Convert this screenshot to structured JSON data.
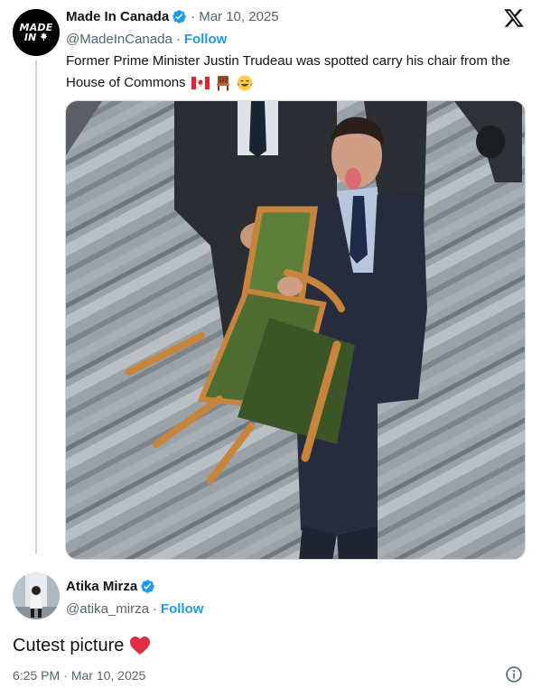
{
  "quoted": {
    "avatar_text": [
      "MADE",
      "IN"
    ],
    "name": "Made In Canada",
    "date": "Mar 10, 2025",
    "handle": "@MadeInCanada",
    "follow_label": "Follow",
    "text": "Former Prime Minister Justin Trudeau was spotted carry his chair from the House of Commons",
    "emojis": [
      "canada-flag-emoji",
      "chair-emoji",
      "joy-emoji"
    ],
    "date_separator": "·"
  },
  "reply": {
    "name": "Atika Mirza",
    "handle": "@atika_mirza",
    "follow_label": "Follow",
    "text": "Cutest picture",
    "time": "6:25 PM",
    "date": "Mar 10, 2025",
    "separator": "·"
  },
  "colors": {
    "accent": "#1d9bf0",
    "secondary_text": "#536471",
    "primary_text": "#0f1419",
    "divider": "#cfd9de",
    "heart": "#f91880"
  },
  "icons": {
    "platform": "x-logo-icon",
    "verified": "verified-badge-icon",
    "info": "info-icon"
  }
}
